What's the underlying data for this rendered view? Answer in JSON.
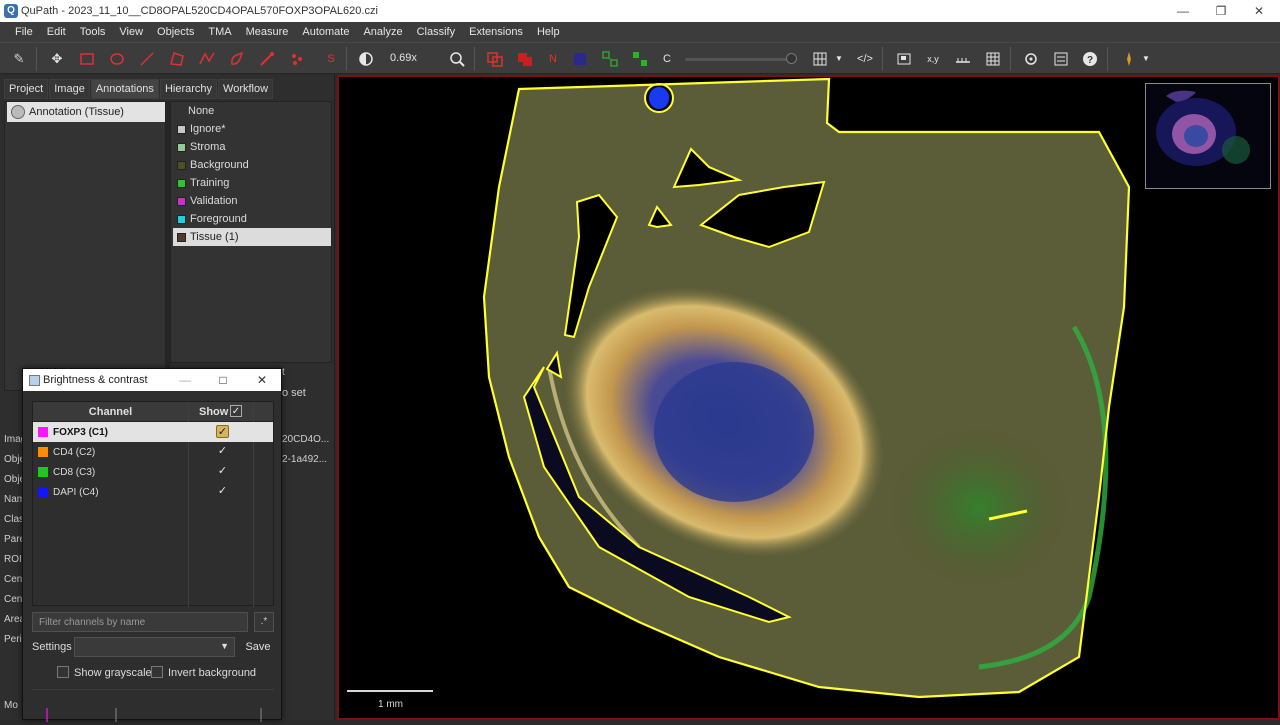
{
  "window": {
    "title": "QuPath - 2023_11_10__CD8OPAL520CD4OPAL570FOXP3OPAL620.czi",
    "icon_letter": "Q"
  },
  "menu": [
    "File",
    "Edit",
    "Tools",
    "View",
    "Objects",
    "TMA",
    "Measure",
    "Automate",
    "Analyze",
    "Classify",
    "Extensions",
    "Help"
  ],
  "toolbar": {
    "zoom": "0.69x",
    "channel_c": "C",
    "channel_n": "N"
  },
  "left_tabs": [
    "Project",
    "Image",
    "Annotations",
    "Hierarchy",
    "Workflow"
  ],
  "annotation_item": "Annotation (Tissue)",
  "classes": [
    {
      "name": "None",
      "color": ""
    },
    {
      "name": "Ignore*",
      "color": "#c8c8c8"
    },
    {
      "name": "Stroma",
      "color": "#96c896"
    },
    {
      "name": "Background",
      "color": "#505028"
    },
    {
      "name": "Training",
      "color": "#28c832"
    },
    {
      "name": "Validation",
      "color": "#c832c8"
    },
    {
      "name": "Foreground",
      "color": "#20d0e0"
    },
    {
      "name": "Tissue (1)",
      "color": "#503c28"
    }
  ],
  "behind_panel": {
    "set": "o set",
    "t": "t",
    "row_labels": [
      "Imag",
      "Obje",
      "Obje",
      "Nam",
      "Clas",
      "Pare",
      "ROI",
      "Cent",
      "Cent",
      "Area",
      "Peri"
    ],
    "values": [
      "20CD4O...",
      "2-1a492..."
    ],
    "bottom": "Mo"
  },
  "viewer": {
    "scale_label": "1 mm",
    "annotation_color": "#ffff32"
  },
  "dialog": {
    "title": "Brightness & contrast",
    "col_channel": "Channel",
    "col_show": "Show",
    "channels": [
      {
        "name": "FOXP3 (C1)",
        "color": "#ff14ff",
        "show": true
      },
      {
        "name": "CD4 (C2)",
        "color": "#ff8c00",
        "show": true
      },
      {
        "name": "CD8 (C3)",
        "color": "#1ec81e",
        "show": true
      },
      {
        "name": "DAPI (C4)",
        "color": "#1414ff",
        "show": true
      }
    ],
    "filter_placeholder": "Filter channels by name",
    "regex": ".*",
    "settings_label": "Settings",
    "save_label": "Save",
    "grayscale_label": "Show grayscale",
    "invert_label": "Invert background"
  }
}
